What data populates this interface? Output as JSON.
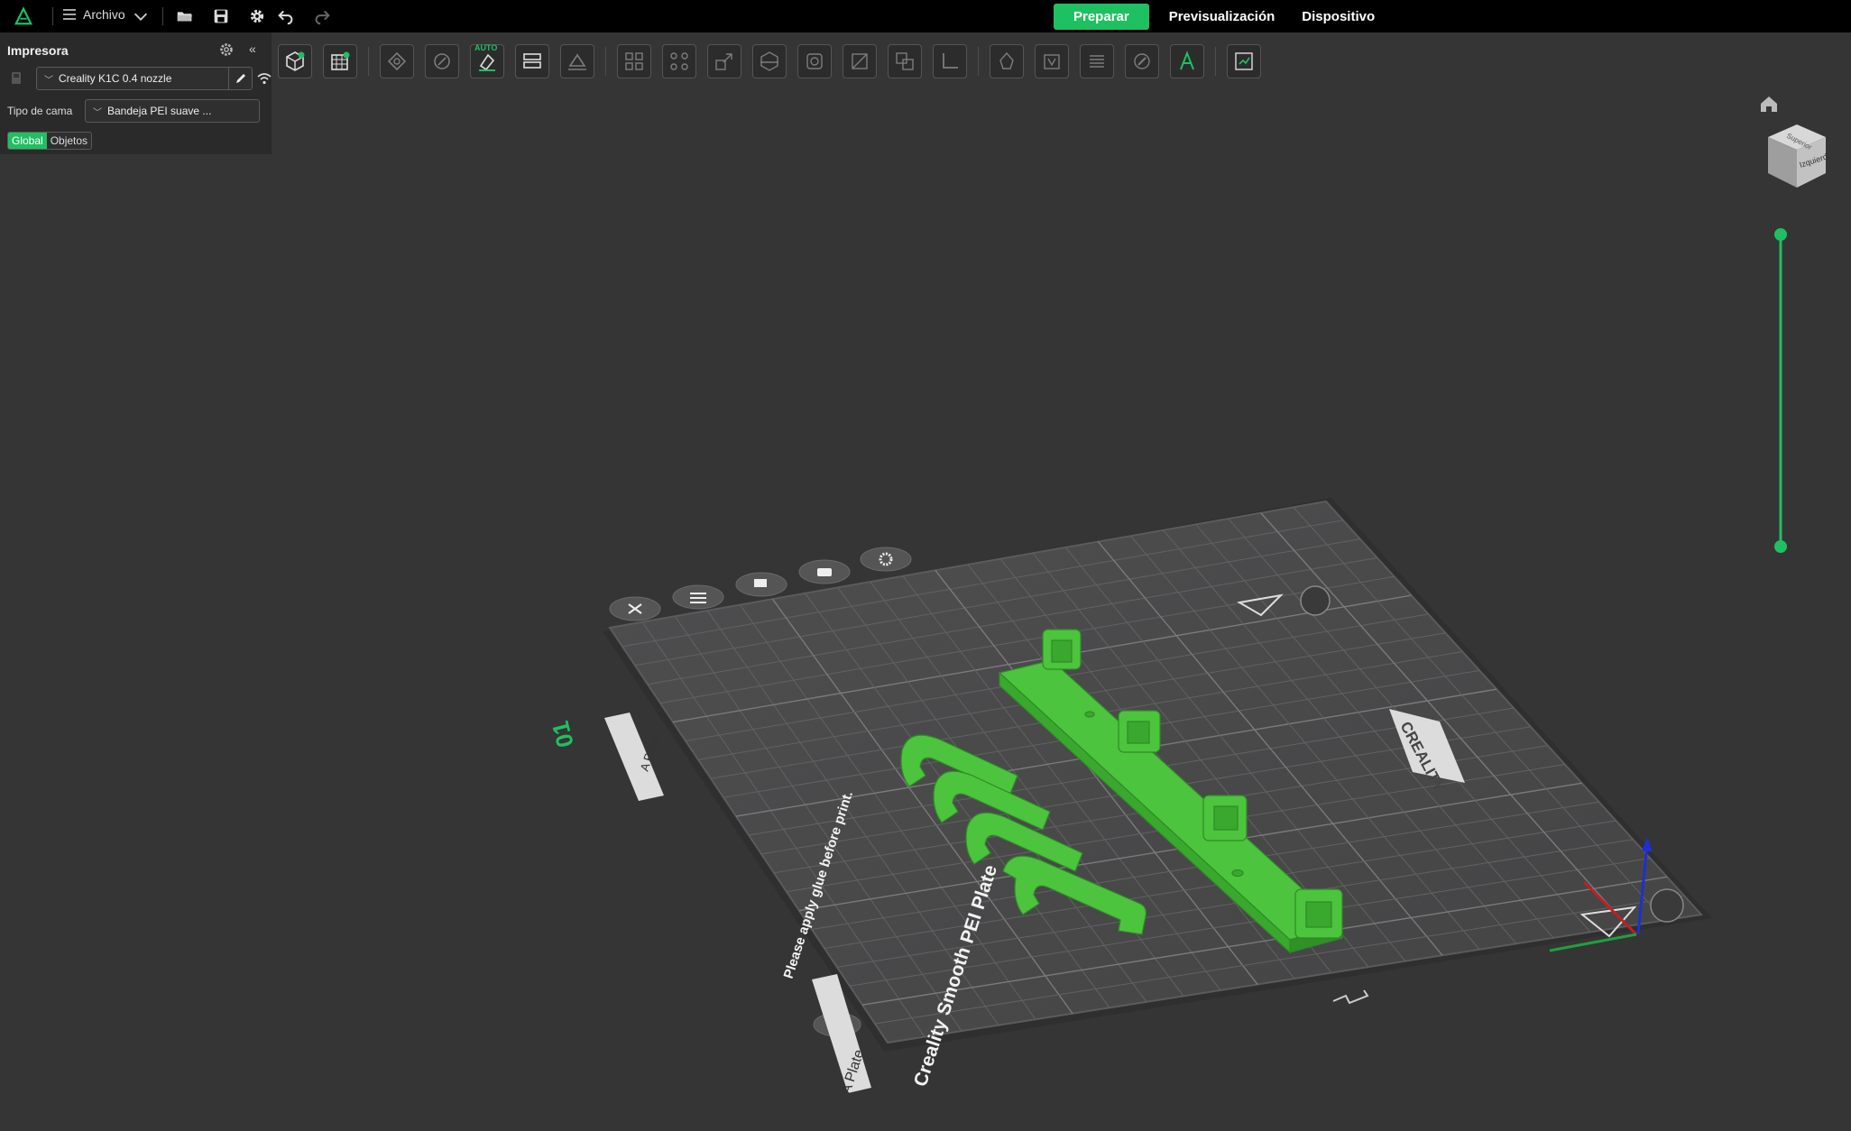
{
  "titlebar": {
    "file_menu_label": "Archivo",
    "tabs": [
      {
        "label": "Preparar",
        "active": true
      },
      {
        "label": "Previsualización",
        "active": false
      },
      {
        "label": "Dispositivo",
        "active": false
      }
    ]
  },
  "left_panel": {
    "title": "Impresora",
    "printer_value": "Creality K1C 0.4 nozzle",
    "bed_label": "Tipo de cama",
    "bed_value": "Bandeja PEI suave ...",
    "scope_global": "Global",
    "scope_objects": "Objetos"
  },
  "toolbar": {
    "auto_tag": "AUTO",
    "tools": [
      "add-object-icon",
      "add-plate-icon",
      "auto-orient-icon",
      "arrange-icon",
      "auto-arrange-icon",
      "split-icon",
      "lay-on-face-icon",
      "layout-grid-icon",
      "distribute-icon",
      "scale-icon",
      "cut-icon",
      "support-icon",
      "seam-icon",
      "boolean-icon",
      "measure-icon",
      "mesh-icon",
      "emboss-icon",
      "hollow-icon",
      "layer-icon",
      "paint-icon",
      "text-icon",
      "assembly-icon"
    ]
  },
  "viewport": {
    "plate_number": "01",
    "plate_label": "A Plate",
    "plate_brand": "CREALITY",
    "plate_text_1": "Creality Smooth PEI Plate",
    "plate_text_2": "Please apply glue before print.",
    "view_cube_label": "Izquierda",
    "view_cube_top": "Superior"
  },
  "colors": {
    "accent": "#1fc061",
    "model": "#4cc43d",
    "background": "#353536",
    "plate": "#4a4a4b"
  }
}
